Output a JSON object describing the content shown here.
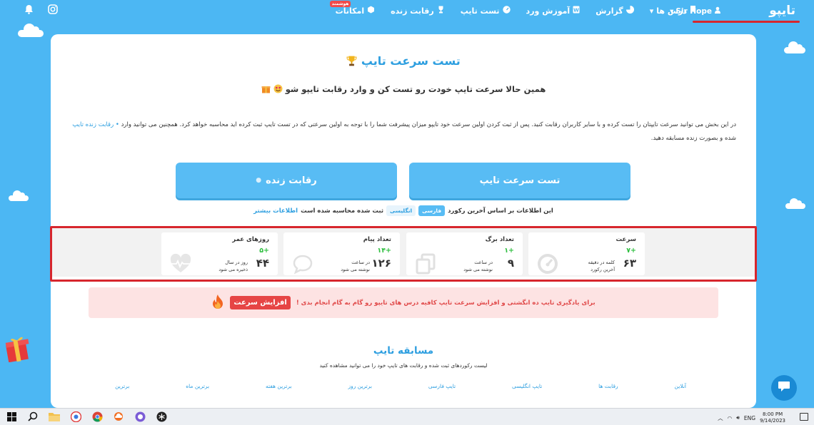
{
  "topbar": {
    "brand": "تایپو",
    "user": "Sir Hope",
    "nav": [
      {
        "label": "درس ها",
        "icon": "bookmark-icon"
      },
      {
        "label": "گزارش",
        "icon": "pie-chart-icon"
      },
      {
        "label": "آموزش ورد",
        "icon": "word-icon"
      },
      {
        "label": "تست تایپ",
        "icon": "speedometer-icon"
      },
      {
        "label": "رقابت زنده",
        "icon": "trophy-icon"
      },
      {
        "label": "امکانات",
        "icon": "cube-icon",
        "badge": "هوشمند"
      }
    ]
  },
  "main": {
    "title": "تست سرعت تایپ",
    "subtitle": "همین حالا سرعت تایپ خودت رو تست کن و وارد رقابت تایپو شو",
    "desc_1": "در این بخش می توانید سرعت تایپتان را تست کرده و با سایر کاربران رقابت کنید. پس از ثبت کردن اولین سرعت خود تایپو میزان پیشرفت شما را با توجه به اولین سرعتی که در تست تایپ ثبت کرده اید محاسبه خواهد کرد. همچنین می توانید وارد",
    "desc_link": "رقابت زنده تایپ",
    "desc_2": "شده و بصورت زنده مسابقه دهید.",
    "btn_test": "تست سرعت تایپ",
    "btn_live": "رقابت زنده",
    "info_pre": "این اطلاعات بر اساس آخرین رکورد",
    "pill_fa": "فارسی",
    "pill_en": "انگلیسی",
    "info_post": "ثبت شده محاسبه شده است",
    "info_more": "اطلاعات بیشتر"
  },
  "stats": [
    {
      "label": "سرعت",
      "delta": "+۷",
      "value": "۶۳",
      "unit1": "کلمه در دقیقه",
      "unit2": "آخرین رکورد",
      "icon": "speedometer-icon"
    },
    {
      "label": "تعداد برگ",
      "delta": "+۱",
      "value": "۹",
      "unit1": "در ساعت",
      "unit2": "نوشته می شود",
      "icon": "pages-icon"
    },
    {
      "label": "تعداد پیام",
      "delta": "+۱۴",
      "value": "۱۲۶",
      "unit1": "در ساعت",
      "unit2": "نوشته می شود",
      "icon": "chat-bubble-icon"
    },
    {
      "label": "روزهای عمر",
      "delta": "+۵",
      "value": "۴۴",
      "unit1": "روز در سال",
      "unit2": "ذخیره می شود",
      "icon": "heartbeat-icon"
    }
  ],
  "alert": {
    "text": "برای یادگیری تایپ ده انگشتی و افزایش سرعت تایپ کافیه درس های تایپو رو گام به گام انجام بدی !",
    "cta": "افزایش سرعت"
  },
  "competition": {
    "title": "مسابقه تایپ",
    "subtitle": "لیست رکوردهای ثبت شده و رقابت های تایپ خود را می توانید مشاهده کنید",
    "tabs": [
      "برترین",
      "برترین ماه",
      "برترین هفته",
      "برترین روز",
      "تایپ فارسی",
      "تایپ انگلیسی",
      "رقابت ها",
      "آنلاین"
    ]
  },
  "taskbar": {
    "lang": "ENG",
    "time": "8:00 PM",
    "date": "9/14/2023"
  },
  "colors": {
    "primary": "#4cb7f3",
    "accent_red": "#d7262d",
    "green": "#2fbf40"
  }
}
